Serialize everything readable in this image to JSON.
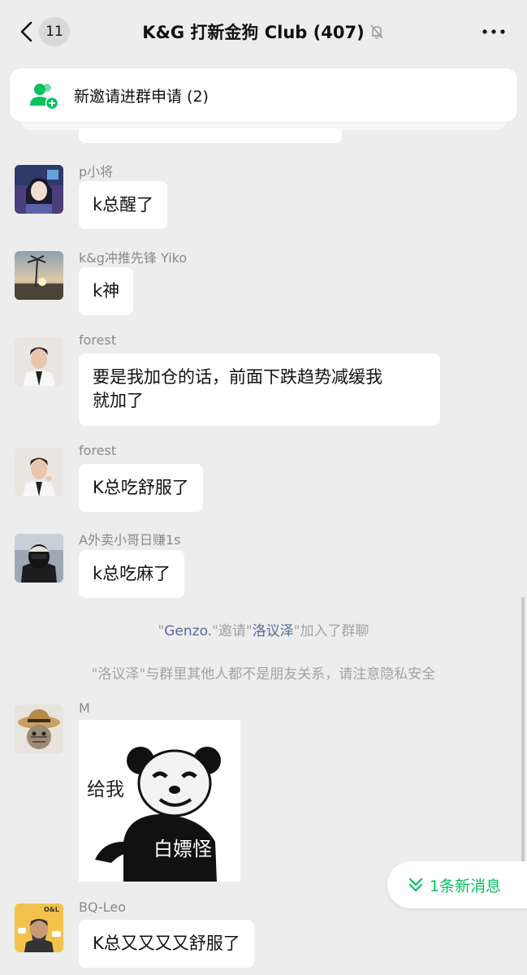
{
  "header": {
    "unread_count": "11",
    "title": "K&G 打新金狗 Club (407)"
  },
  "invite_banner": {
    "text": "新邀请进群申请 (2)"
  },
  "messages": [
    {
      "sender": "p小将",
      "text": "k总醒了"
    },
    {
      "sender": "k&g冲推先锋 Yiko",
      "text": "k神"
    },
    {
      "sender": "forest",
      "text_line1": "要是我加仓的话，前面下跌趋势减缓我",
      "text_line2": "就加了"
    },
    {
      "sender": "forest",
      "text": "K总吃舒服了"
    },
    {
      "sender": "A外卖小哥日赚1s",
      "text": "k总吃麻了"
    },
    {
      "sender": "M",
      "sticker_left": "给我",
      "sticker_belly": "白嫖怪"
    },
    {
      "sender": "BQ-Leo",
      "text": "K总又又又又舒服了",
      "avatar_badge": "O&L"
    }
  ],
  "system": {
    "invite_q1": "\"",
    "invite_name1": "Genzo.",
    "invite_mid": "\"邀请\"",
    "invite_name2": "洛议泽",
    "invite_end": "\"加入了群聊",
    "privacy_notice": "\"洛议泽\"与群里其他人都不是朋友关系，请注意隐私安全"
  },
  "new_messages_pill": {
    "text": "1条新消息"
  },
  "colors": {
    "background": "#ededed",
    "bubble": "#ffffff",
    "link": "#576b95",
    "accent_green": "#07c160",
    "system_text": "#a3a3a3"
  },
  "icons": [
    "chevron-left-icon",
    "mute-bell-icon",
    "more-icon",
    "group-invite-icon",
    "double-chevron-down-icon"
  ]
}
